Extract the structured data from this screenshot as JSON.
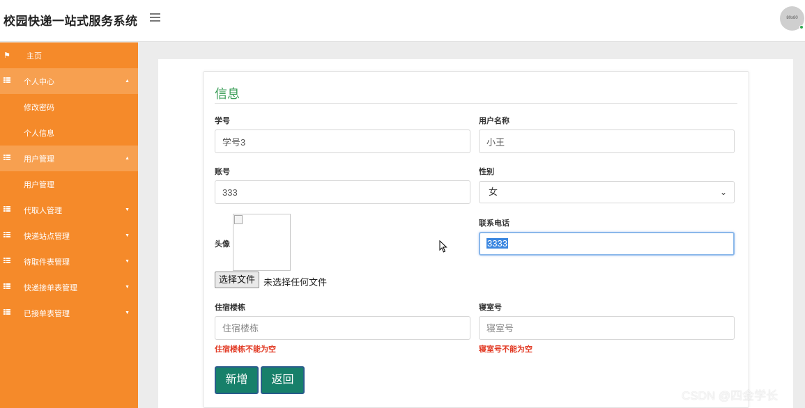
{
  "header": {
    "app_title": "校园快递一站式服务系统",
    "avatar_text": "80x80"
  },
  "sidebar": {
    "items": [
      {
        "label": "主页",
        "icon": "flag-icon"
      },
      {
        "label": "个人中心",
        "icon": "grid-icon",
        "expanded": true
      },
      {
        "label": "修改密码",
        "sub": true
      },
      {
        "label": "个人信息",
        "sub": true
      },
      {
        "label": "用户管理",
        "icon": "grid-icon",
        "expanded": true
      },
      {
        "label": "用户管理",
        "sub": true
      },
      {
        "label": "代取人管理",
        "icon": "grid-icon"
      },
      {
        "label": "快递站点管理",
        "icon": "grid-icon"
      },
      {
        "label": "待取件表管理",
        "icon": "grid-icon"
      },
      {
        "label": "快递接单表管理",
        "icon": "grid-icon"
      },
      {
        "label": "已接单表管理",
        "icon": "grid-icon"
      }
    ]
  },
  "form": {
    "title": "信息",
    "student_id": {
      "label": "学号",
      "value": "学号3"
    },
    "username": {
      "label": "用户名称",
      "value": "小王"
    },
    "account": {
      "label": "账号",
      "value": "333"
    },
    "gender": {
      "label": "性别",
      "value": "女"
    },
    "avatar": {
      "label": "头像",
      "choose_button": "选择文件",
      "no_file_text": "未选择任何文件"
    },
    "phone": {
      "label": "联系电话",
      "value": "3333"
    },
    "building": {
      "label": "住宿楼栋",
      "placeholder": "住宿楼栋",
      "error": "住宿楼栋不能为空"
    },
    "dorm": {
      "label": "寝室号",
      "placeholder": "寝室号",
      "error": "寝室号不能为空"
    },
    "submit_label": "新增",
    "back_label": "返回"
  },
  "watermark": "CSDN @四金学长",
  "colors": {
    "sidebar_bg": "#f58a2a",
    "sidebar_active": "#f7a050",
    "title_green": "#3a9d57",
    "button_bg": "#17806a",
    "error_red": "#e23b25"
  }
}
